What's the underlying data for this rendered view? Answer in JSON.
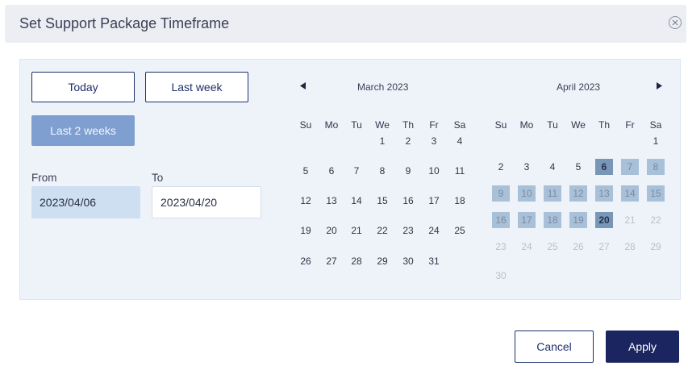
{
  "dialog": {
    "title": "Set Support Package Timeframe",
    "close_icon": "close-circle-icon"
  },
  "presets": {
    "today": "Today",
    "last_week": "Last week",
    "last_2_weeks": "Last 2 weeks",
    "active": "last_2_weeks"
  },
  "range": {
    "from_label": "From",
    "from_value": "2023/04/06",
    "to_label": "To",
    "to_value": "2023/04/20"
  },
  "weekdays": [
    "Su",
    "Mo",
    "Tu",
    "We",
    "Th",
    "Fr",
    "Sa"
  ],
  "calendars": [
    {
      "title": "March 2023",
      "first_weekday": 3,
      "days": 31,
      "range_start": null,
      "range_end": null,
      "muted_after": null
    },
    {
      "title": "April 2023",
      "first_weekday": 6,
      "days": 30,
      "range_start": 6,
      "range_end": 20,
      "muted_after": 20
    }
  ],
  "nav": {
    "prev_icon": "triangle-left-icon",
    "next_icon": "triangle-right-icon"
  },
  "actions": {
    "cancel": "Cancel",
    "apply": "Apply"
  },
  "colors": {
    "primary": "#1b2660",
    "active_preset": "#7f9fd0",
    "range_fill": "#a9c0d9",
    "range_endpoint": "#7896b8",
    "from_field": "#cddff1"
  }
}
